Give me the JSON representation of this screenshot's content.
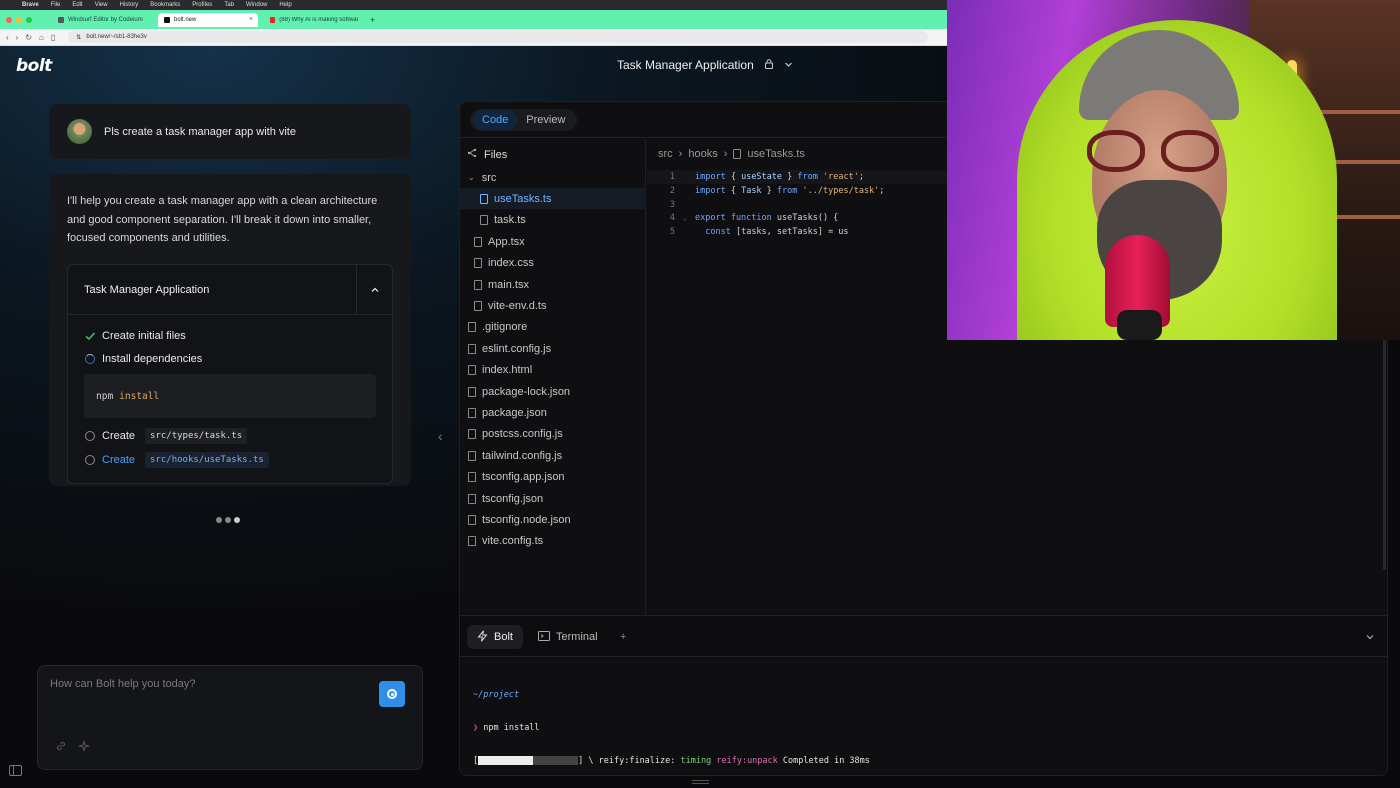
{
  "mac_menu": {
    "items": [
      "Brave",
      "File",
      "Edit",
      "View",
      "History",
      "Bookmarks",
      "Profiles",
      "Tab",
      "Window",
      "Help"
    ]
  },
  "browser": {
    "tabs": [
      {
        "label": "Windsurf Editor by Codeium",
        "active": false
      },
      {
        "label": "bolt.new",
        "active": true
      },
      {
        "label": "(88) Why AI is making software ...",
        "active": false
      }
    ],
    "new_tab": "+",
    "url": "bolt.new/~/sb1-83he3v"
  },
  "app": {
    "logo": "bolt",
    "title": "Task Manager Application"
  },
  "chat": {
    "user_message": "Pls create a task manager app with vite",
    "assistant_message": "I'll help you create a task manager app with a clean architecture and good component separation. I'll break it down into smaller, focused components and utilities.",
    "artifact": {
      "title": "Task Manager Application",
      "steps": [
        {
          "label": "Create initial files",
          "status": "done"
        },
        {
          "label": "Install dependencies",
          "status": "running"
        },
        {
          "label": "Create",
          "file": "src/types/task.ts",
          "status": "pending"
        },
        {
          "label": "Create",
          "file": "src/hooks/useTasks.ts",
          "status": "pending"
        }
      ],
      "command": {
        "cmd": "npm",
        "arg": "install"
      }
    },
    "input_placeholder": "How can Bolt help you today?"
  },
  "workbench": {
    "tabs": [
      {
        "label": "Code",
        "active": true
      },
      {
        "label": "Preview",
        "active": false
      }
    ],
    "files_label": "Files",
    "tree": [
      {
        "name": "src",
        "type": "dir",
        "depth": 0
      },
      {
        "name": "useTasks.ts",
        "type": "file",
        "depth": 2,
        "selected": true
      },
      {
        "name": "task.ts",
        "type": "file",
        "depth": 2
      },
      {
        "name": "App.tsx",
        "type": "file",
        "depth": 1
      },
      {
        "name": "index.css",
        "type": "file",
        "depth": 1
      },
      {
        "name": "main.tsx",
        "type": "file",
        "depth": 1
      },
      {
        "name": "vite-env.d.ts",
        "type": "file",
        "depth": 1
      },
      {
        "name": ".gitignore",
        "type": "file",
        "depth": 0
      },
      {
        "name": "eslint.config.js",
        "type": "file",
        "depth": 0
      },
      {
        "name": "index.html",
        "type": "file",
        "depth": 0
      },
      {
        "name": "package-lock.json",
        "type": "file",
        "depth": 0
      },
      {
        "name": "package.json",
        "type": "file",
        "depth": 0
      },
      {
        "name": "postcss.config.js",
        "type": "file",
        "depth": 0
      },
      {
        "name": "tailwind.config.js",
        "type": "file",
        "depth": 0
      },
      {
        "name": "tsconfig.app.json",
        "type": "file",
        "depth": 0
      },
      {
        "name": "tsconfig.json",
        "type": "file",
        "depth": 0
      },
      {
        "name": "tsconfig.node.json",
        "type": "file",
        "depth": 0
      },
      {
        "name": "vite.config.ts",
        "type": "file",
        "depth": 0
      }
    ],
    "breadcrumb": [
      "src",
      "hooks",
      "useTasks.ts"
    ],
    "code_lines": [
      {
        "n": "1",
        "tokens": [
          [
            "kw",
            "import"
          ],
          [
            "plain",
            " { "
          ],
          [
            "ident",
            "useState"
          ],
          [
            "plain",
            " } "
          ],
          [
            "kw",
            "from"
          ],
          [
            "plain",
            " "
          ],
          [
            "str",
            "'react'"
          ],
          [
            "plain",
            ";"
          ]
        ]
      },
      {
        "n": "2",
        "tokens": [
          [
            "kw",
            "import"
          ],
          [
            "plain",
            " { "
          ],
          [
            "ident",
            "Task"
          ],
          [
            "plain",
            " } "
          ],
          [
            "kw",
            "from"
          ],
          [
            "plain",
            " "
          ],
          [
            "str",
            "'../types/task'"
          ],
          [
            "plain",
            ";"
          ]
        ]
      },
      {
        "n": "3",
        "tokens": []
      },
      {
        "n": "4",
        "fold": true,
        "tokens": [
          [
            "kw",
            "export function "
          ],
          [
            "plain",
            "useTasks() {"
          ]
        ]
      },
      {
        "n": "5",
        "tokens": [
          [
            "plain",
            "  "
          ],
          [
            "kw",
            "const"
          ],
          [
            "plain",
            " [tasks, setTasks] = us"
          ]
        ]
      }
    ],
    "bottom_tabs": [
      {
        "label": "Bolt",
        "active": true
      },
      {
        "label": "Terminal",
        "active": false
      }
    ],
    "add_tab": "+",
    "terminal": {
      "path": "~/project",
      "prompt_symbol": "❯",
      "command": "npm install",
      "progress": 0.55,
      "spinner": "\\",
      "task": "reify:finalize:",
      "timing_label": "timing",
      "timing_target": "reify:unpack",
      "result": "Completed in 38ms"
    }
  },
  "colors": {
    "accent": "#2f8fe8",
    "tab_bar": "#60f0b0",
    "done_check": "#4cbf6a"
  }
}
